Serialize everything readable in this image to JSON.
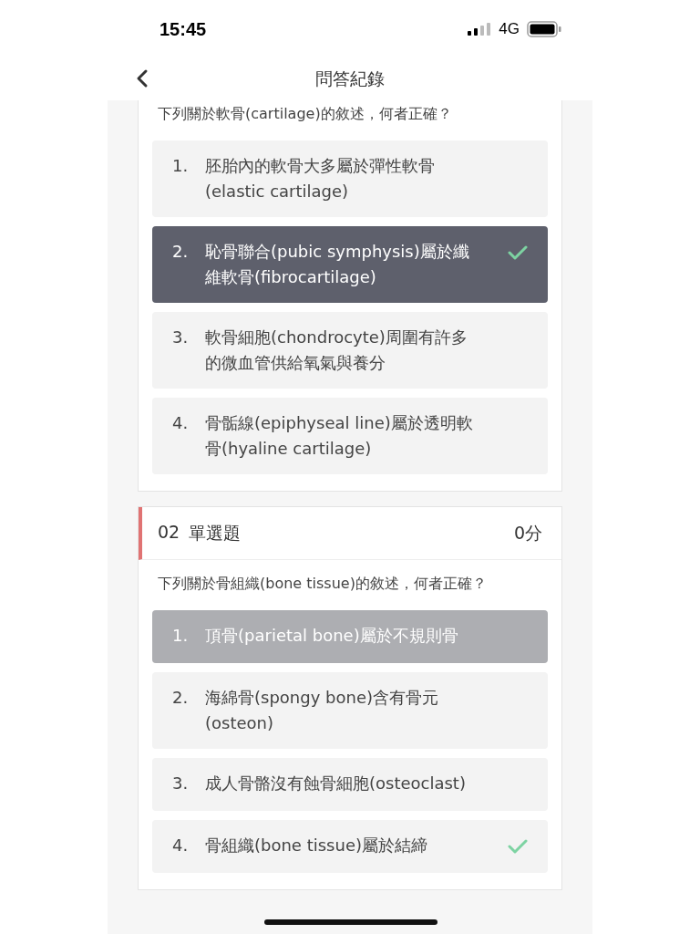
{
  "status_bar": {
    "time": "15:45",
    "network": "4G"
  },
  "header": {
    "title": "問答紀錄"
  },
  "questions": [
    {
      "prompt": "下列關於軟骨(cartilage)的敘述，何者正確？",
      "options": [
        {
          "number": "1.",
          "text": "胚胎內的軟骨大多屬於彈性軟骨(elastic cartilage)",
          "selected": false,
          "correct": false
        },
        {
          "number": "2.",
          "text": "恥骨聯合(pubic symphysis)屬於纖維軟骨(fibrocartilage)",
          "selected": true,
          "correct": true
        },
        {
          "number": "3.",
          "text": "軟骨細胞(chondrocyte)周圍有許多的微血管供給氧氣與養分",
          "selected": false,
          "correct": false
        },
        {
          "number": "4.",
          "text": "骨骺線(epiphyseal line)屬於透明軟骨(hyaline cartilage)",
          "selected": false,
          "correct": false
        }
      ]
    },
    {
      "number": "02",
      "type": "單選題",
      "score": "0分",
      "prompt": "下列關於骨組織(bone tissue)的敘述，何者正確？",
      "options": [
        {
          "number": "1.",
          "text": "頂骨(parietal bone)屬於不規則骨",
          "selected": true,
          "correct": false
        },
        {
          "number": "2.",
          "text": "海綿骨(spongy bone)含有骨元(osteon)",
          "selected": false,
          "correct": false
        },
        {
          "number": "3.",
          "text": "成人骨骼沒有蝕骨細胞(osteoclast)",
          "selected": false,
          "correct": false
        },
        {
          "number": "4.",
          "text": "骨組織(bone tissue)屬於結締",
          "selected": false,
          "correct": true
        }
      ]
    }
  ]
}
